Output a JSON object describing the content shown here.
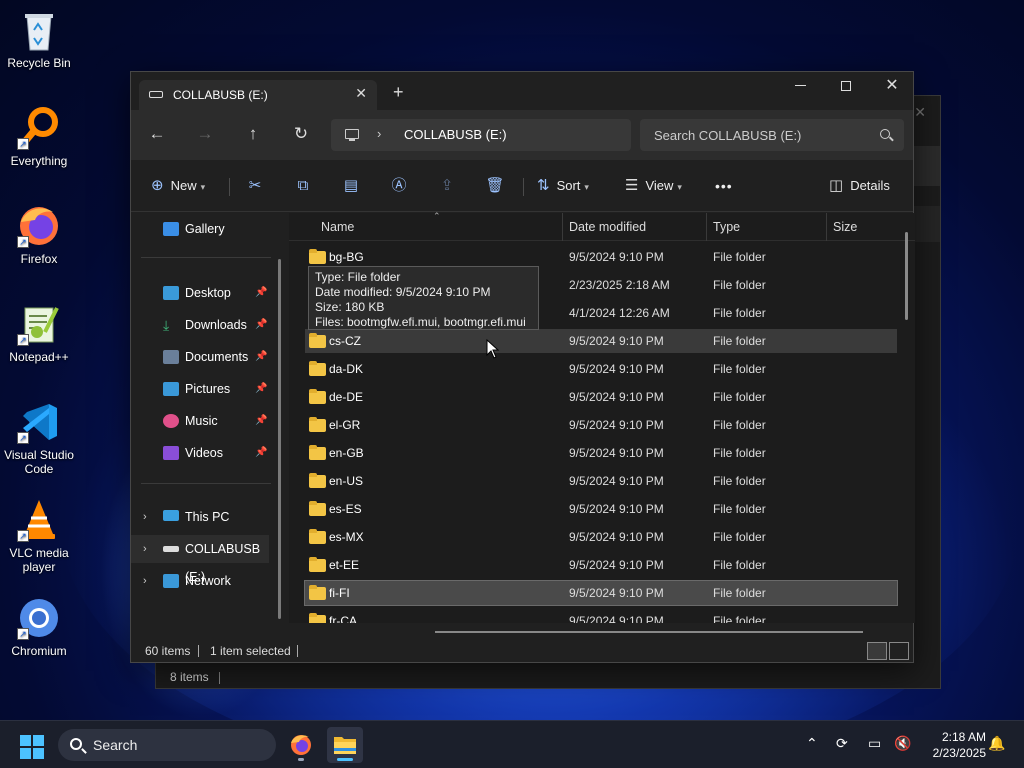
{
  "desktop": {
    "icons": [
      {
        "label": "Recycle Bin"
      },
      {
        "label": "Everything"
      },
      {
        "label": "Firefox"
      },
      {
        "label": "Notepad++"
      },
      {
        "label": "Visual Studio Code"
      },
      {
        "label": "VLC media player"
      },
      {
        "label": "Chromium"
      }
    ]
  },
  "back_window": {
    "status_items": "8 items"
  },
  "explorer": {
    "tab_title": "COLLABUSB (E:)",
    "new_tab": "+",
    "address": "COLLABUSB (E:)",
    "search_placeholder": "Search COLLABUSB (E:)",
    "toolbar": {
      "new_label": "New",
      "sort_label": "Sort",
      "view_label": "View",
      "more_label": "•••",
      "details_label": "Details"
    },
    "nav": {
      "gallery": "Gallery",
      "desktop": "Desktop",
      "downloads": "Downloads",
      "documents": "Documents",
      "pictures": "Pictures",
      "music": "Music",
      "videos": "Videos",
      "this_pc": "This PC",
      "collabusb": "COLLABUSB (E:)",
      "network": "Network"
    },
    "columns": {
      "name": "Name",
      "date": "Date modified",
      "type": "Type",
      "size": "Size"
    },
    "rows": [
      {
        "name": "bg-BG",
        "date": "9/5/2024 9:10 PM",
        "type": "File folder"
      },
      {
        "name": "",
        "date": "2/23/2025 2:18 AM",
        "type": "File folder"
      },
      {
        "name": "",
        "date": "4/1/2024 12:26 AM",
        "type": "File folder"
      },
      {
        "name": "cs-CZ",
        "date": "9/5/2024 9:10 PM",
        "type": "File folder"
      },
      {
        "name": "da-DK",
        "date": "9/5/2024 9:10 PM",
        "type": "File folder"
      },
      {
        "name": "de-DE",
        "date": "9/5/2024 9:10 PM",
        "type": "File folder"
      },
      {
        "name": "el-GR",
        "date": "9/5/2024 9:10 PM",
        "type": "File folder"
      },
      {
        "name": "en-GB",
        "date": "9/5/2024 9:10 PM",
        "type": "File folder"
      },
      {
        "name": "en-US",
        "date": "9/5/2024 9:10 PM",
        "type": "File folder"
      },
      {
        "name": "es-ES",
        "date": "9/5/2024 9:10 PM",
        "type": "File folder"
      },
      {
        "name": "es-MX",
        "date": "9/5/2024 9:10 PM",
        "type": "File folder"
      },
      {
        "name": "et-EE",
        "date": "9/5/2024 9:10 PM",
        "type": "File folder"
      },
      {
        "name": "fi-FI",
        "date": "9/5/2024 9:10 PM",
        "type": "File folder"
      },
      {
        "name": "fr-CA",
        "date": "9/5/2024 9:10 PM",
        "type": "File folder"
      }
    ],
    "tooltip": {
      "line1": "Type: File folder",
      "line2": "Date modified: 9/5/2024 9:10 PM",
      "line3": "Size: 180 KB",
      "line4": "Files: bootmgfw.efi.mui, bootmgr.efi.mui"
    },
    "status": {
      "items": "60 items",
      "selected": "1 item selected"
    }
  },
  "taskbar": {
    "search_placeholder": "Search",
    "time": "2:18 AM",
    "date": "2/23/2025"
  },
  "colors": {
    "accent": "#4cc2ff",
    "folder": "#f3c545",
    "window_bg": "#202020",
    "selected_row": "#4a4a4a"
  }
}
